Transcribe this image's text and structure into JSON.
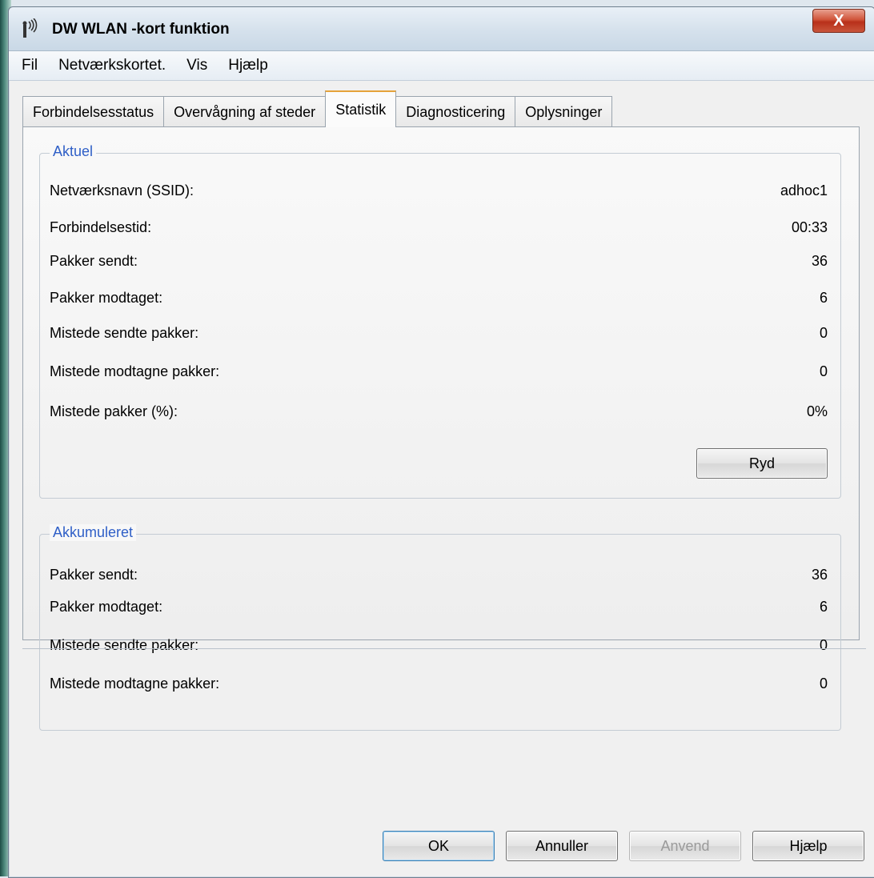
{
  "window": {
    "title": "DW WLAN -kort funktion",
    "close_symbol": "X"
  },
  "menu": [
    "Fil",
    "Netværkskortet.",
    "Vis",
    "Hjælp"
  ],
  "tabs": [
    {
      "label": "Forbindelsesstatus",
      "active": false
    },
    {
      "label": "Overvågning af steder",
      "active": false
    },
    {
      "label": "Statistik",
      "active": true
    },
    {
      "label": "Diagnosticering",
      "active": false
    },
    {
      "label": "Oplysninger",
      "active": false
    }
  ],
  "current": {
    "legend": "Aktuel",
    "rows": [
      {
        "label": "Netværksnavn (SSID):",
        "value": "adhoc1"
      },
      {
        "label": "Forbindelsestid:",
        "value": "00:33"
      },
      {
        "label": "Pakker sendt:",
        "value": "36"
      },
      {
        "label": "Pakker modtaget:",
        "value": "6"
      },
      {
        "label": "Mistede sendte pakker:",
        "value": "0"
      },
      {
        "label": "Mistede modtagne pakker:",
        "value": "0"
      },
      {
        "label": "Mistede pakker (%):",
        "value": "0%"
      }
    ],
    "clear_button": "Ryd"
  },
  "accumulated": {
    "legend": "Akkumuleret",
    "rows": [
      {
        "label": "Pakker sendt:",
        "value": "36"
      },
      {
        "label": "Pakker modtaget:",
        "value": "6"
      },
      {
        "label": "Mistede sendte pakker:",
        "value": "0"
      },
      {
        "label": "Mistede modtagne pakker:",
        "value": "0"
      }
    ]
  },
  "buttons": {
    "ok": "OK",
    "cancel": "Annuller",
    "apply": "Anvend",
    "help": "Hjælp"
  },
  "icons": {
    "app": "wireless-signal-icon"
  }
}
